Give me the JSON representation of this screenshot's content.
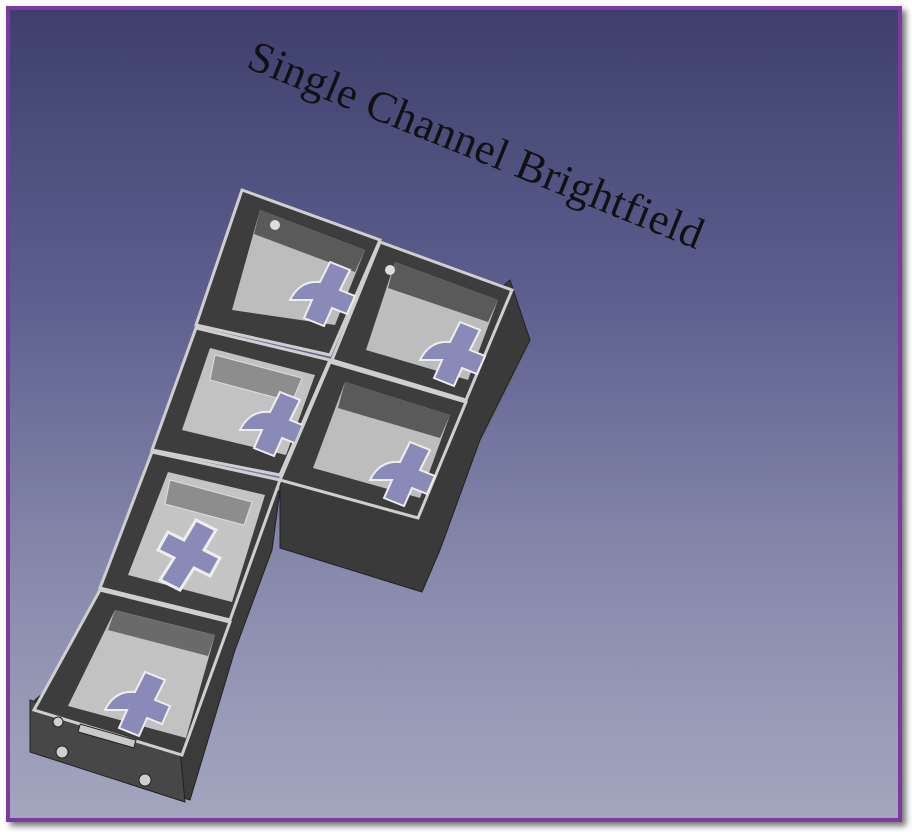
{
  "title": "Single Channel Brightfield",
  "colors": {
    "frame": "#7a3aa0",
    "background_top": "#3e3f6c",
    "background_bottom": "#a4a6bf",
    "model_wall": "#3d3d3d",
    "model_floor": "#c8c8c8",
    "model_highlight": "#d9d9d9",
    "cutout": "#8a8ab8"
  }
}
